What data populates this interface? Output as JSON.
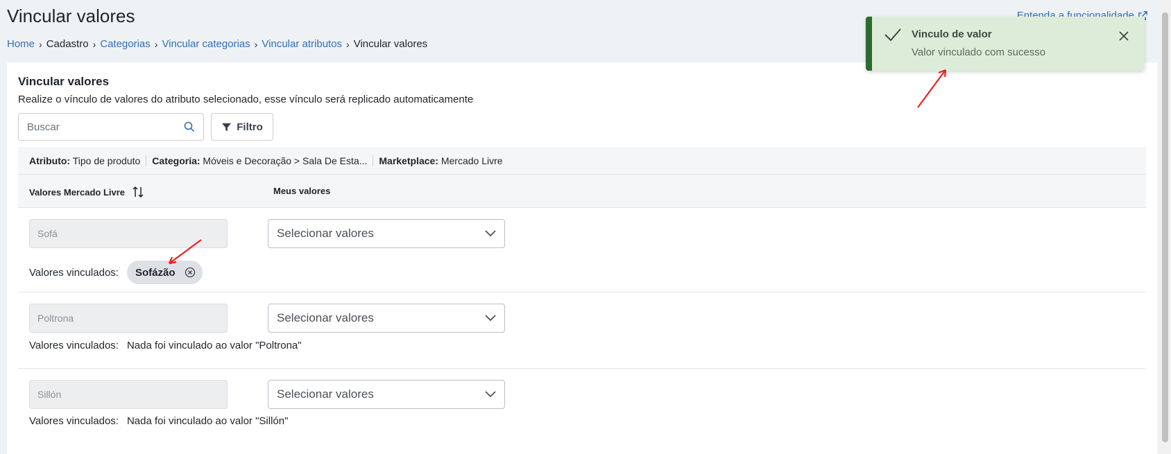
{
  "page": {
    "title": "Vincular valores",
    "help_link": "Entenda a funcionalidade"
  },
  "breadcrumb": [
    {
      "label": "Home",
      "link": true
    },
    {
      "label": "Cadastro",
      "link": false
    },
    {
      "label": "Categorias",
      "link": true
    },
    {
      "label": "Vincular categorias",
      "link": true
    },
    {
      "label": "Vincular atributos",
      "link": true
    },
    {
      "label": "Vincular valores",
      "link": false
    }
  ],
  "card": {
    "title": "Vincular valores",
    "description": "Realize o vínculo de valores do atributo selecionado, esse vínculo será replicado automaticamente",
    "search_placeholder": "Buscar",
    "filter_label": "Filtro"
  },
  "info": {
    "attr_label": "Atributo:",
    "attr_value": "Tipo de produto",
    "cat_label": "Categoria:",
    "cat_value": "Móveis e Decoração > Sala De Esta...",
    "mkt_label": "Marketplace:",
    "mkt_value": "Mercado Livre"
  },
  "table": {
    "col_ml": "Valores Mercado Livre",
    "col_mine": "Meus valores",
    "linked_label": "Valores vinculados:",
    "rows": [
      {
        "ml_value": "Sofá",
        "select_placeholder": "Selecionar valores",
        "chip": "Sofázão",
        "empty_msg": ""
      },
      {
        "ml_value": "Poltrona",
        "select_placeholder": "Selecionar valores",
        "chip": "",
        "empty_msg": "Nada foi vinculado ao valor \"Poltrona\""
      },
      {
        "ml_value": "Sillón",
        "select_placeholder": "Selecionar valores",
        "chip": "",
        "empty_msg": "Nada foi vinculado ao valor \"Sillón\""
      }
    ]
  },
  "toast": {
    "title": "Vinculo de valor",
    "message": "Valor vinculado com sucesso"
  },
  "colors": {
    "link": "#2f6fbe",
    "toast_bg": "#ddecd9",
    "toast_accent": "#2d6a2f",
    "annotation_arrow": "#e8211e"
  }
}
